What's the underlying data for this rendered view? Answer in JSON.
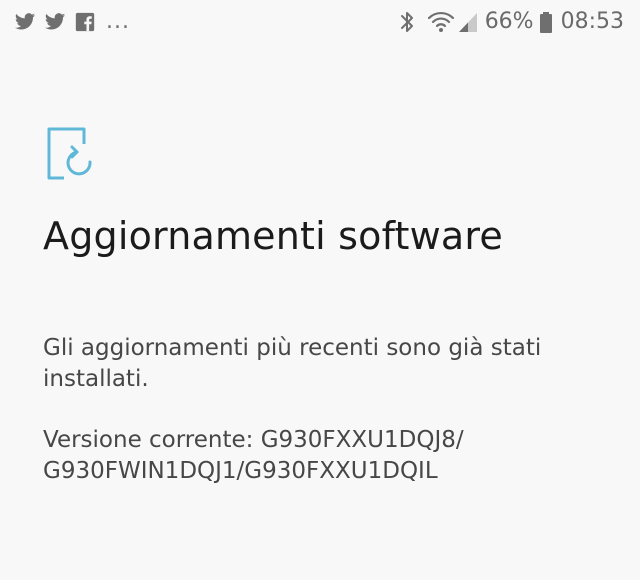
{
  "status_bar": {
    "notifications": [
      {
        "icon": "twitter-icon"
      },
      {
        "icon": "twitter-icon"
      },
      {
        "icon": "facebook-icon"
      }
    ],
    "more_indicator": "...",
    "battery_percent": "66%",
    "time": "08:53",
    "icon_color": "#6f6f6f"
  },
  "main": {
    "icon": "software-update-icon",
    "icon_color": "#5fb8d8",
    "title": "Aggiornamenti software",
    "status_message": "Gli aggiornamenti più recenti sono già stati installati.",
    "version_label": "Versione corrente: G930FXXU1DQJ8/\nG930FWIN1DQJ1/G930FXXU1DQIL"
  }
}
